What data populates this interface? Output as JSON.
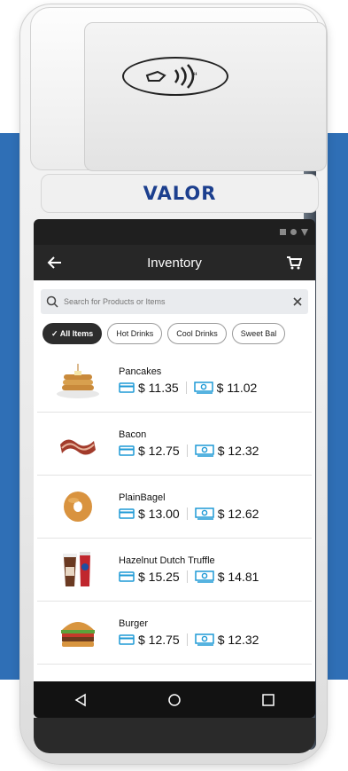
{
  "device": {
    "brand": "VALOR"
  },
  "appbar": {
    "title": "Inventory"
  },
  "search": {
    "placeholder": "Search for Products or Items"
  },
  "chips": [
    {
      "label": "✓ All Items",
      "active": true
    },
    {
      "label": "Hot Drinks",
      "active": false
    },
    {
      "label": "Cool Drinks",
      "active": false
    },
    {
      "label": "Sweet Bal",
      "active": false
    }
  ],
  "items": [
    {
      "name": "Pancakes",
      "card_price": "$ 11.35",
      "cash_price": "$ 11.02",
      "icon": "pancakes-icon"
    },
    {
      "name": "Bacon",
      "card_price": "$ 12.75",
      "cash_price": "$ 12.32",
      "icon": "bacon-icon"
    },
    {
      "name": "PlainBagel",
      "card_price": "$ 13.00",
      "cash_price": "$ 12.62",
      "icon": "bagel-icon"
    },
    {
      "name": "Hazelnut Dutch Truffle",
      "card_price": "$ 15.25",
      "cash_price": "$ 14.81",
      "icon": "drinks-icon"
    },
    {
      "name": "Burger",
      "card_price": "$ 12.75",
      "cash_price": "$ 12.32",
      "icon": "burger-icon"
    }
  ],
  "colors": {
    "accent": "#1e9ad6",
    "background_band": "#2f6fb6",
    "brand": "#1c3f8e"
  }
}
